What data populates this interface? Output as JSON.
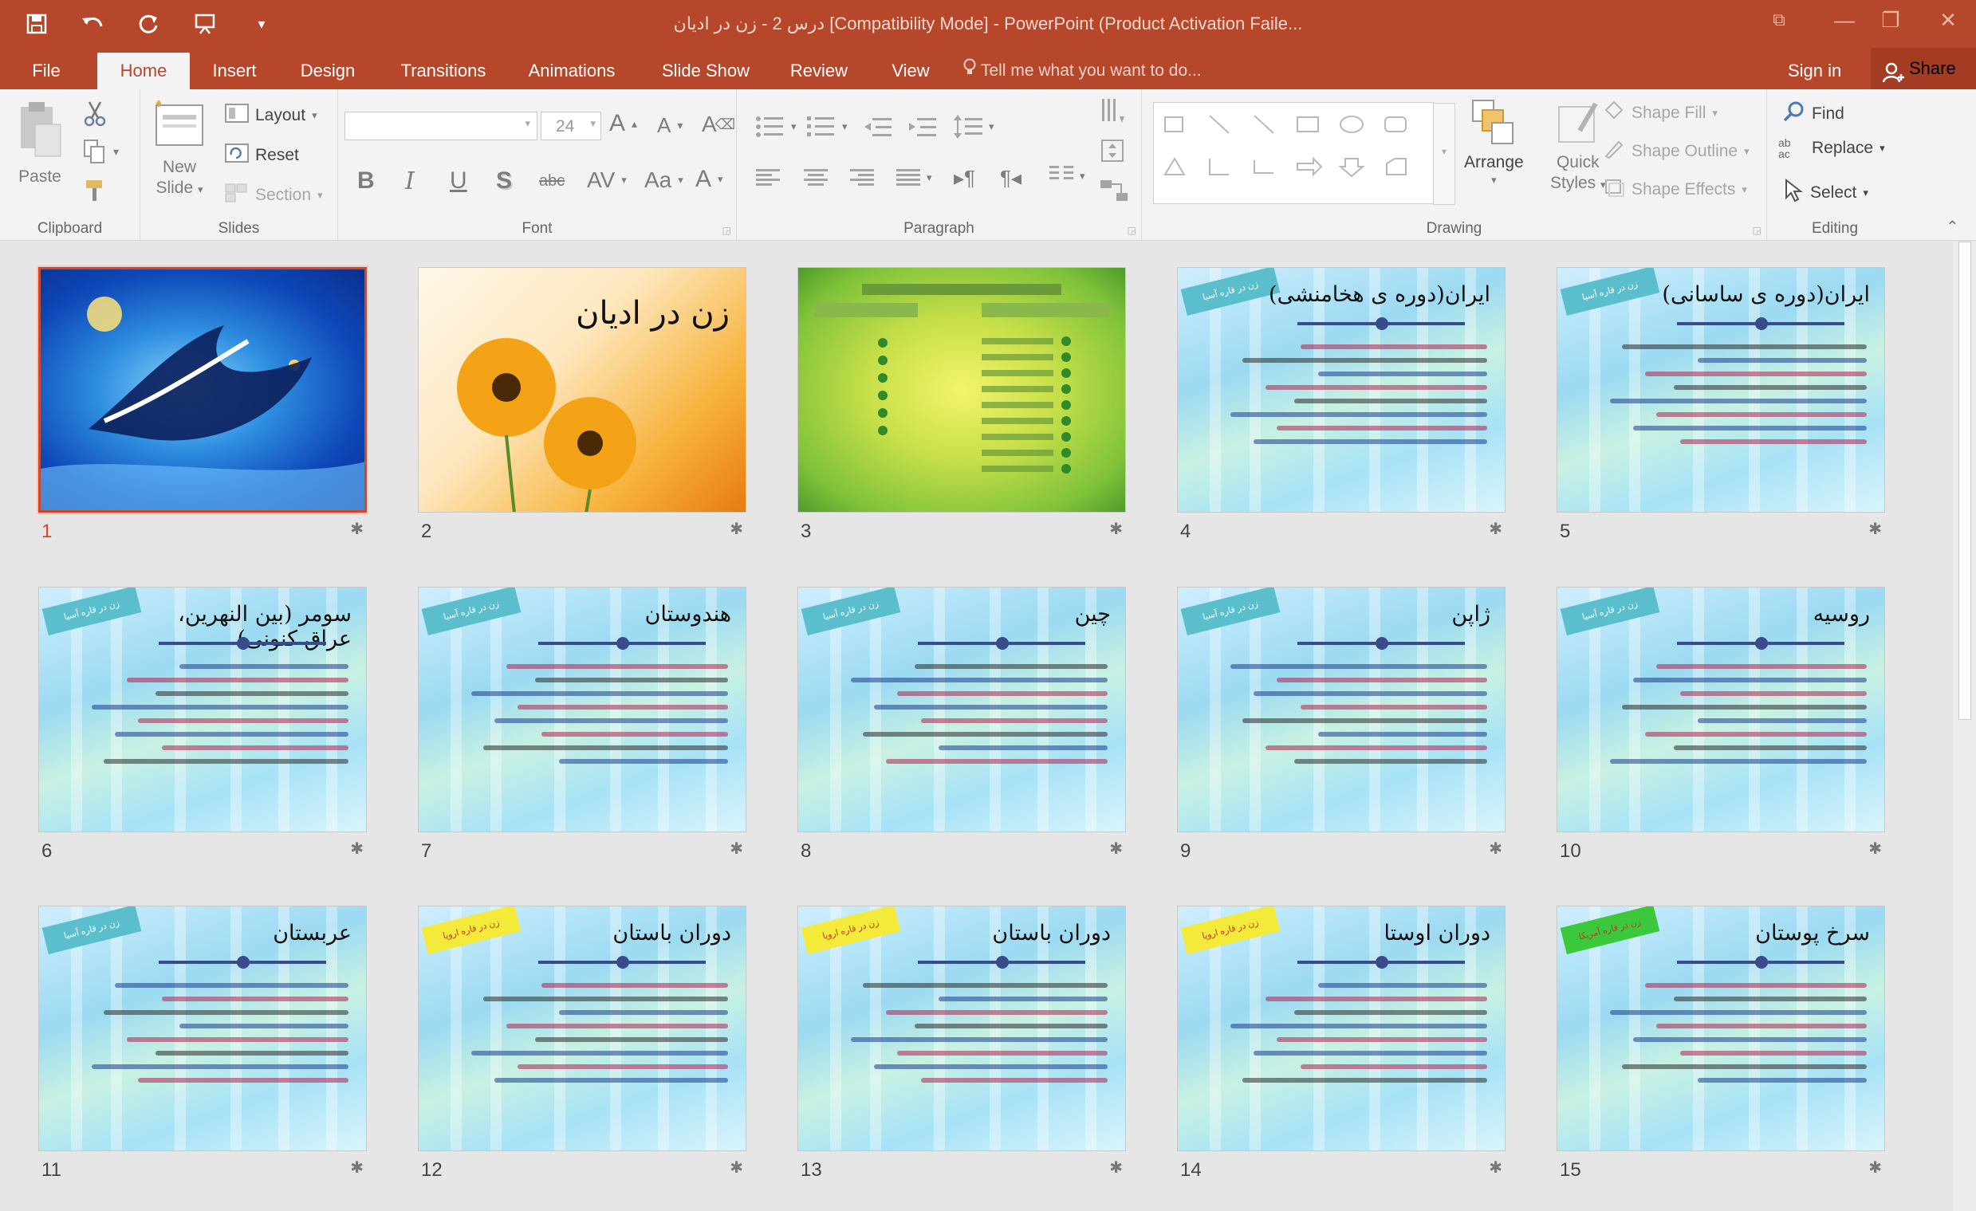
{
  "window": {
    "title": "درس 2 - زن در ادیان [Compatibility Mode] - PowerPoint (Product Activation Faile...",
    "accent": "#b7472a"
  },
  "tabs": [
    {
      "label": "File"
    },
    {
      "label": "Home"
    },
    {
      "label": "Insert"
    },
    {
      "label": "Design"
    },
    {
      "label": "Transitions"
    },
    {
      "label": "Animations"
    },
    {
      "label": "Slide Show"
    },
    {
      "label": "Review"
    },
    {
      "label": "View"
    }
  ],
  "tell_me": "Tell me what you want to do...",
  "sign_in": "Sign in",
  "share": "Share",
  "ribbon": {
    "clipboard": {
      "label": "Clipboard",
      "paste": "Paste"
    },
    "slides": {
      "label": "Slides",
      "new_slide_1": "New",
      "new_slide_2": "Slide",
      "layout": "Layout",
      "reset": "Reset",
      "section": "Section"
    },
    "font": {
      "label": "Font",
      "size": "24"
    },
    "paragraph": {
      "label": "Paragraph"
    },
    "drawing": {
      "label": "Drawing",
      "arrange": "Arrange",
      "quick_styles_1": "Quick",
      "quick_styles_2": "Styles",
      "shape_fill": "Shape Fill",
      "shape_outline": "Shape Outline",
      "shape_effects": "Shape Effects"
    },
    "editing": {
      "label": "Editing",
      "find": "Find",
      "replace": "Replace",
      "select": "Select"
    }
  },
  "slides": [
    {
      "num": "1",
      "title": "",
      "style": "blue-calligraphy",
      "selected": true
    },
    {
      "num": "2",
      "title": "زن در ادیان",
      "style": "flowers"
    },
    {
      "num": "3",
      "title": "",
      "style": "green-map"
    },
    {
      "num": "4",
      "title": "ایران(دوره ی هخامنشی)",
      "style": "sky",
      "flag": "زن در قاره آسیا",
      "flag_color": "blue"
    },
    {
      "num": "5",
      "title": "ایران(دوره ی ساسانی)",
      "style": "sky",
      "flag": "زن در قاره آسیا",
      "flag_color": "blue"
    },
    {
      "num": "6",
      "title": "سومر (بین النهرین، عراق کنونی)",
      "style": "sky",
      "flag": "زن در قاره آسیا",
      "flag_color": "blue"
    },
    {
      "num": "7",
      "title": "هندوستان",
      "style": "sky",
      "flag": "زن در قاره آسیا",
      "flag_color": "blue"
    },
    {
      "num": "8",
      "title": "چین",
      "style": "sky",
      "flag": "زن در قاره آسیا",
      "flag_color": "blue"
    },
    {
      "num": "9",
      "title": "ژاپن",
      "style": "sky",
      "flag": "زن در قاره آسیا",
      "flag_color": "blue"
    },
    {
      "num": "10",
      "title": "روسیه",
      "style": "sky",
      "flag": "زن در قاره آسیا",
      "flag_color": "blue"
    },
    {
      "num": "11",
      "title": "عربستان",
      "style": "sky",
      "flag": "زن در قاره آسیا",
      "flag_color": "blue"
    },
    {
      "num": "12",
      "title": "دوران باستان",
      "style": "sky",
      "flag": "زن در قاره اروپا",
      "flag_color": "yellow"
    },
    {
      "num": "13",
      "title": "دوران باستان",
      "style": "sky",
      "flag": "زن در قاره اروپا",
      "flag_color": "yellow"
    },
    {
      "num": "14",
      "title": "دوران اوستا",
      "style": "sky",
      "flag": "زن در قاره اروپا",
      "flag_color": "yellow"
    },
    {
      "num": "15",
      "title": "سرخ پوستان",
      "style": "sky",
      "flag": "زن در قاره آمریکا",
      "flag_color": "green"
    }
  ]
}
